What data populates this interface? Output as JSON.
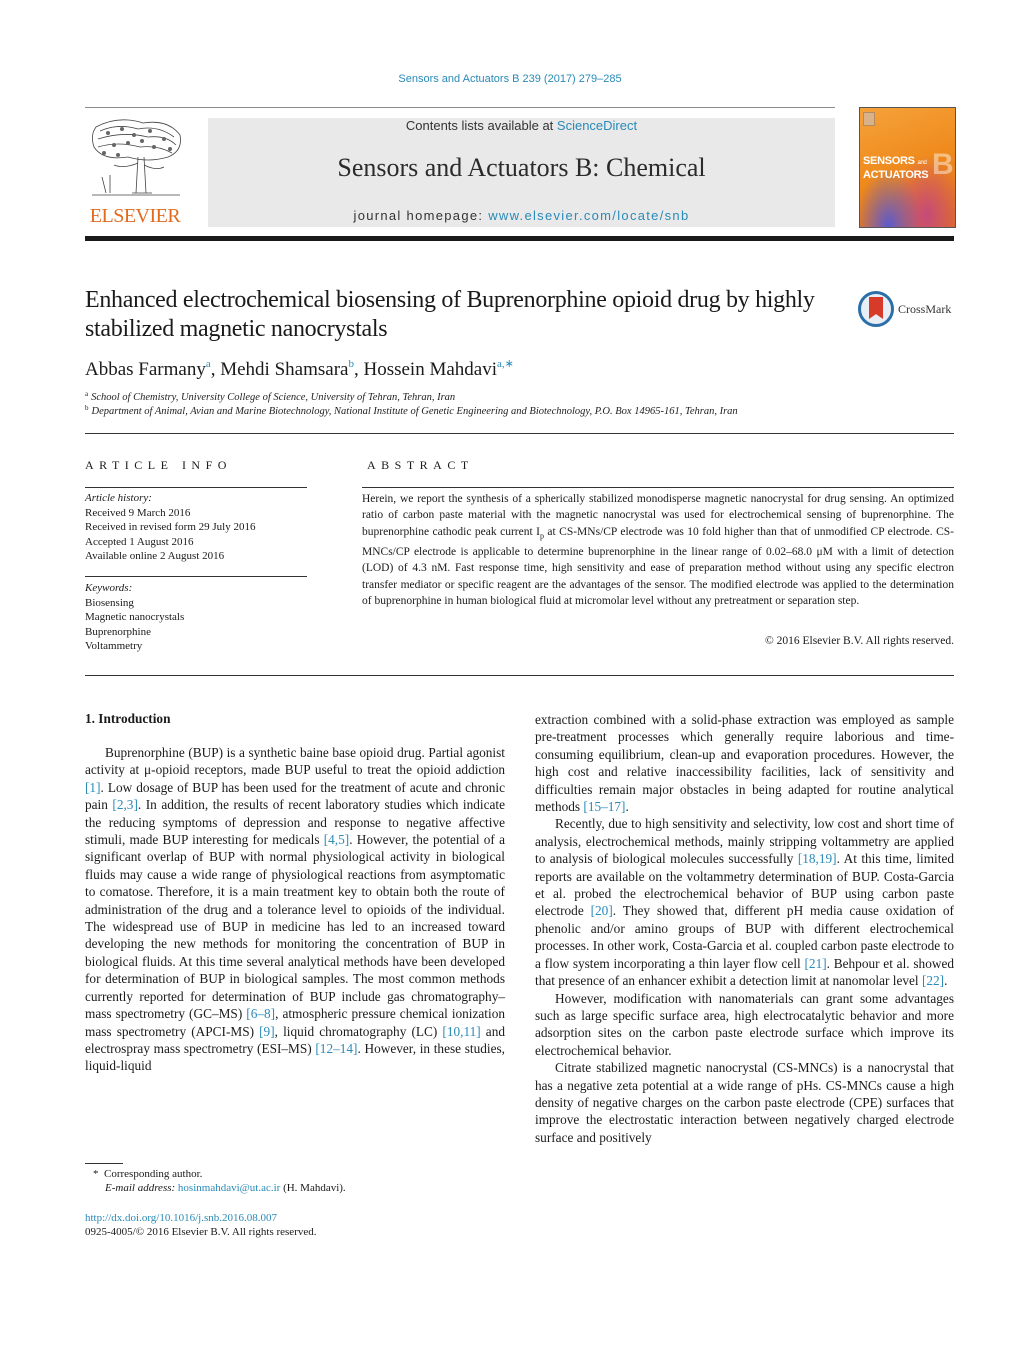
{
  "header": {
    "citation": "Sensors and Actuators B 239 (2017) 279–285",
    "contents_prefix": "Contents lists available at ",
    "contents_link": "ScienceDirect",
    "journal_title": "Sensors and Actuators B: Chemical",
    "homepage_prefix": "journal homepage: ",
    "homepage_link": "www.elsevier.com/locate/snb",
    "publisher_logo_text": "ELSEVIER",
    "cover": {
      "title_line1": "SENSORS",
      "title_and": "and",
      "title_line2": "ACTUATORS",
      "letter": "B"
    }
  },
  "article": {
    "title": "Enhanced electrochemical biosensing of Buprenorphine opioid drug by highly stabilized magnetic nanocrystals",
    "crossmark_label": "CrossMark",
    "authors": [
      {
        "name": "Abbas Farmany",
        "sup": "a"
      },
      {
        "name": "Mehdi Shamsara",
        "sup": "b"
      },
      {
        "name": "Hossein Mahdavi",
        "sup": "a,∗"
      }
    ],
    "affiliations": [
      {
        "sup": "a",
        "text": "School of Chemistry, University College of Science, University of Tehran, Tehran, Iran"
      },
      {
        "sup": "b",
        "text": "Department of Animal, Avian and Marine Biotechnology, National Institute of Genetic Engineering and Biotechnology, P.O. Box 14965-161, Tehran, Iran"
      }
    ]
  },
  "article_info": {
    "heading": "ARTICLE INFO",
    "history_label": "Article history:",
    "history": [
      "Received 9 March 2016",
      "Received in revised form 29 July 2016",
      "Accepted 1 August 2016",
      "Available online 2 August 2016"
    ],
    "keywords_label": "Keywords:",
    "keywords": [
      "Biosensing",
      "Magnetic nanocrystals",
      "Buprenorphine",
      "Voltammetry"
    ]
  },
  "abstract": {
    "heading": "ABSTRACT",
    "text_1": "Herein, we report the synthesis of a spherically stabilized monodisperse magnetic nanocrystal for drug sensing. An optimized ratio of carbon paste material with the magnetic nanocrystal was used for electrochemical sensing of buprenorphine. The buprenorphine cathodic peak current I",
    "text_sub": "p",
    "text_2": " at CS-MNs/CP electrode was 10 fold higher than that of unmodified CP electrode. CS-MNCs/CP electrode is applicable to determine buprenorphine in the linear range of 0.02–68.0 μM with a limit of detection (LOD) of 4.3 nM. Fast response time, high sensitivity and ease of preparation method without using any specific electron transfer mediator or specific reagent are the advantages of the sensor. The modified electrode was applied to the determination of buprenorphine in human biological fluid at micromolar level without any pretreatment or separation step.",
    "copyright": "© 2016 Elsevier B.V. All rights reserved."
  },
  "introduction": {
    "heading": "1.  Introduction",
    "p1": [
      {
        "t": "Buprenorphine (BUP) is a synthetic baine base opioid drug. Partial agonist activity at μ-opioid receptors, made BUP useful to treat the opioid addiction "
      },
      {
        "c": "[1]"
      },
      {
        "t": ". Low dosage of BUP has been used for the treatment of acute and chronic pain "
      },
      {
        "c": "[2,3]"
      },
      {
        "t": ". In addition, the results of recent laboratory studies which indicate the reducing symptoms of depression and response to negative affective stimuli, made BUP interesting for medicals "
      },
      {
        "c": "[4,5]"
      },
      {
        "t": ". However, the potential of a significant overlap of BUP with normal physiological activity in biological fluids may cause a wide range of physiological reactions from asymptomatic to comatose. Therefore, it is a main treatment key to obtain both the route of administration of the drug and a tolerance level to opioids of the individual. The widespread use of BUP in medicine has led to an increased toward developing the new methods for monitoring the concentration of BUP in biological fluids. At this time several analytical methods have been developed for determination of BUP in biological samples. The most common methods currently reported for determination of BUP include gas chromatography–mass spectrometry (GC–MS) "
      },
      {
        "c": "[6–8]"
      },
      {
        "t": ", atmospheric pressure chemical ionization mass spectrometry (APCI-MS) "
      },
      {
        "c": "[9]"
      },
      {
        "t": ", liquid chromatography (LC) "
      },
      {
        "c": "[10,11]"
      },
      {
        "t": " and electrospray mass spectrometry (ESI–MS) "
      },
      {
        "c": "[12–14]"
      },
      {
        "t": ". However, in these studies, liquid-liquid extraction combined with a solid-phase extraction was employed as sample pre-treatment processes which generally require laborious and time-consuming equilibrium, clean-up and evaporation procedures. However, the high cost and relative inaccessibility facilities, lack of sensitivity and difficulties remain major obstacles in being adapted for routine analytical methods "
      },
      {
        "c": "[15–17]"
      },
      {
        "t": "."
      }
    ],
    "p2": [
      {
        "t": "Recently, due to high sensitivity and selectivity, low cost and short time of analysis, electrochemical methods, mainly stripping voltammetry are applied to analysis of biological molecules successfully "
      },
      {
        "c": "[18,19]"
      },
      {
        "t": ". At this time, limited reports are available on the voltammetry determination of BUP. Costa-Garcia et al. probed the electrochemical behavior of BUP using carbon paste electrode "
      },
      {
        "c": "[20]"
      },
      {
        "t": ". They showed that, different pH media cause oxidation of phenolic and/or amino groups of BUP with different electrochemical processes. In other work, Costa-Garcia et al. coupled carbon paste electrode to a flow system incorporating a thin layer flow cell "
      },
      {
        "c": "[21]"
      },
      {
        "t": ". Behpour et al. showed that presence of an enhancer exhibit a detection limit at nanomolar level "
      },
      {
        "c": "[22]"
      },
      {
        "t": "."
      }
    ],
    "p3": "However, modification with nanomaterials can grant some advantages such as large specific surface area, high electrocatalytic behavior and more adsorption sites on the carbon paste electrode surface which improve its electrochemical behavior.",
    "p4": "Citrate stabilized magnetic nanocrystal (CS-MNCs) is a nanocrystal that has a negative zeta potential at a wide range of pHs. CS-MNCs cause a high density of negative charges on the carbon paste electrode (CPE) surfaces that improve the electrostatic interaction between negatively charged electrode surface and positively"
  },
  "footer": {
    "corresponding_mark": "*",
    "corresponding_text": "Corresponding author.",
    "email_label": "E-mail address:",
    "email": "hosinmahdavi@ut.ac.ir",
    "email_suffix": " (H. Mahdavi).",
    "doi": "http://dx.doi.org/10.1016/j.snb.2016.08.007",
    "issn": "0925-4005/© 2016 Elsevier B.V. All rights reserved."
  },
  "colors": {
    "link": "#2a8ab8",
    "elsevier_orange": "#e06b1f",
    "header_box": "#e9e9e9"
  }
}
